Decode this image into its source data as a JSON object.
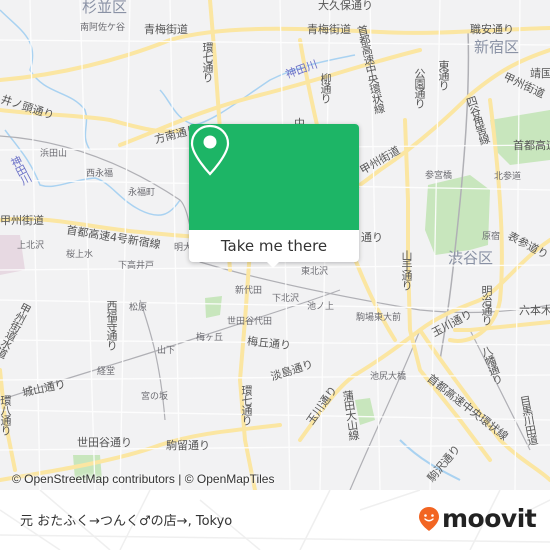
{
  "map": {
    "districts": [
      "杉並区",
      "新宿区",
      "渋谷区"
    ],
    "roads": {
      "ome_kaido_w": "青梅街道",
      "ome_kaido_e": "青梅街道",
      "kan7_n": "環七通り",
      "kan7_s": "環七通り",
      "inokashira": "井ノ頭通り",
      "hounan": "方南通り",
      "koshu_w": "甲州街道",
      "koshu_e": "甲州街道",
      "shuto4": "首都高速4号新宿線",
      "shuto_chuo_n": "首都高速中央環状線",
      "shuto_chuo_s": "首都高速中央環状線",
      "yanagi": "柳通り",
      "koen": "公園通り",
      "higashi": "東通り",
      "shokuan": "職安通り",
      "okubo": "大久保通り",
      "yasukuni": "靖国通り",
      "yotsuya": "四谷角筈線",
      "shuto_east": "首都高速",
      "yamate_n": "山手通り",
      "yamate_s": "山手通り",
      "omotesando": "表参道り",
      "meiji": "明治通り",
      "roppongi": "六本木通り",
      "tamagawa_e": "玉川通り",
      "tamagawa_s": "玉川通り",
      "hachiman": "八幡通り",
      "komazawa": "駒沢通り",
      "komadome": "駒留通り",
      "setagaya": "世田谷通り",
      "jouyama": "城山通り",
      "nishifukuji": "西福寺通り",
      "umegaoka": "梅丘通り",
      "awashima": "淡島通り",
      "kamata": "蒲田大山線",
      "suido": "甲州街道水道",
      "kanpachi": "環八通り",
      "meguro": "目黒川田道",
      "dori_partial": "通り",
      "chu": "中"
    },
    "rivers": {
      "kanda_e": "神田川",
      "kanda_w": "神田川"
    },
    "places": {
      "minami_asagaya": "南阿佐ケ谷",
      "hamadayama": "浜田山",
      "nishieifuku": "西永福",
      "eifukucho": "永福町",
      "kamikitazawa": "上北沢",
      "sakurajosui": "桜上水",
      "shimotakaido": "下高井戸",
      "meidaimae": "明大",
      "matsubara": "松原",
      "yamashita": "山下",
      "kyodo": "経堂",
      "miyanosaka": "宮の坂",
      "shindaita": "新代田",
      "shimokitazawa": "下北沢",
      "higashikitazawa": "東北沢",
      "ikenoue": "池ノ上",
      "setagayadaita": "世田谷代田",
      "umegaoka": "梅ヶ丘",
      "komabatodaimae": "駒場東大前",
      "ikejiriohashi": "池尻大橋",
      "sangubashi": "参宮橋",
      "kitasando": "北参道",
      "harajuku": "原宿"
    }
  },
  "popup": {
    "cta_label": "Take me there",
    "icon": "location-pin-icon",
    "accent": "#1db566"
  },
  "attribution": "© OpenStreetMap contributors | © OpenMapTiles",
  "footer": {
    "place_name": "元 おたふく→つんく♂の店→, Tokyo",
    "brand": "moovit",
    "brand_color": "#f26522"
  }
}
